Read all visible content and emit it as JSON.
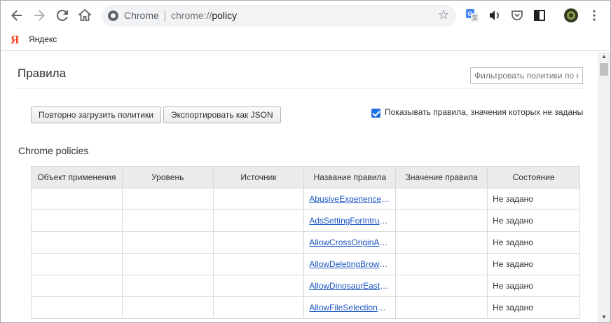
{
  "browser": {
    "omnibox_site": "Chrome",
    "omnibox_url_scheme": "chrome://",
    "omnibox_url_path": "policy"
  },
  "bookmarks": {
    "items": [
      {
        "label": "Яндекс",
        "logo": "Я"
      }
    ]
  },
  "page": {
    "title": "Правила",
    "filter_placeholder": "Фильтровать политики по названию",
    "reload_button": "Повторно загрузить политики",
    "export_button": "Экспортировать как JSON",
    "show_unset_label": "Показывать правила, значения которых не заданы",
    "show_unset_checked": true,
    "section_title": "Chrome policies"
  },
  "table": {
    "headers": [
      "Объект применения",
      "Уровень",
      "Источник",
      "Название правила",
      "Значение правила",
      "Состояние"
    ],
    "rows": [
      {
        "name": "AbusiveExperienceInterventionEnforce",
        "status": "Не задано"
      },
      {
        "name": "AdsSettingForIntrusiveAdsSites",
        "status": "Не задано"
      },
      {
        "name": "AllowCrossOriginAuthPrompt",
        "status": "Не задано"
      },
      {
        "name": "AllowDeletingBrowserHistory",
        "status": "Не задано"
      },
      {
        "name": "AllowDinosaurEasterEgg",
        "status": "Не задано"
      },
      {
        "name": "AllowFileSelectionDialogs",
        "status": "Не задано"
      }
    ]
  },
  "icons": {
    "back": "arrow-left-icon",
    "forward": "arrow-right-icon",
    "reload": "reload-icon",
    "home": "home-icon",
    "bookmark_star": "star-icon",
    "translate": "translate-icon",
    "audio": "speaker-icon",
    "pocket": "pocket-icon",
    "reader": "reader-icon",
    "profile": "avatar-icon",
    "menu": "kebab-menu-icon"
  },
  "colors": {
    "link": "#1a55c2",
    "accent": "#1a73e8",
    "yandex": "#fc3f1d"
  }
}
